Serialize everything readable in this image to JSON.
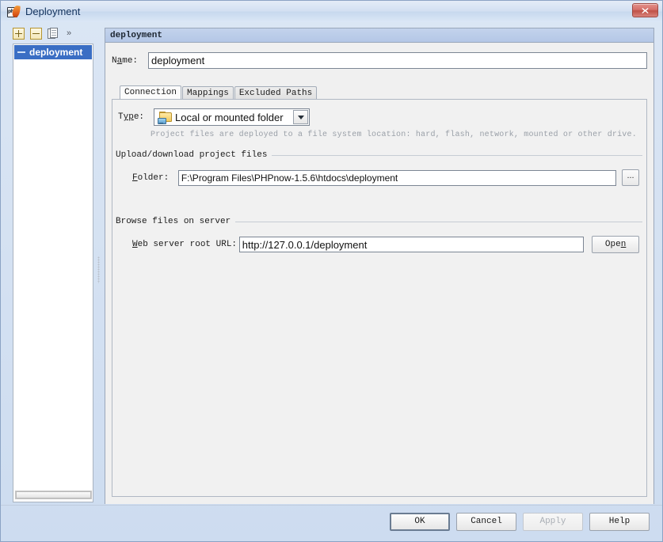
{
  "window": {
    "title": "Deployment",
    "icon": "php-flame-icon",
    "close_label": "close-icon",
    "accent_blue": "#3a6ec4",
    "header_blue": "#b4c7e6",
    "close_red": "#bf5148"
  },
  "sidebar": {
    "toolbar": [
      {
        "name": "add-button",
        "label": "+"
      },
      {
        "name": "remove-button",
        "label": "−"
      },
      {
        "name": "copy-button",
        "label": "copy"
      },
      {
        "name": "overflow-button",
        "label": "»"
      }
    ],
    "items": [
      {
        "label": "deployment",
        "selected": true
      }
    ]
  },
  "panel": {
    "header_title": "deployment",
    "name_label": "Name:",
    "name_label_pre": "N",
    "name_label_mn": "a",
    "name_label_post": "me:",
    "name_value": "deployment",
    "tabs": [
      {
        "label": "Connection",
        "active": true
      },
      {
        "label": "Mappings",
        "active": false
      },
      {
        "label": "Excluded Paths",
        "active": false
      }
    ],
    "type": {
      "label_pre": "T",
      "label_mn": "yp",
      "label_post": "e:",
      "label": "Type:",
      "value": "Local or mounted folder",
      "icon": "folder-mounted-icon",
      "arrow": "chevron-down-icon",
      "description": "Project files are deployed to a file system location: hard, flash, network, mounted or other drive."
    },
    "upload_group": {
      "title": "Upload/download project files",
      "folder_label": "Folder:",
      "folder_label_pre": "",
      "folder_label_mn": "F",
      "folder_label_post": "older:",
      "folder_value": "F:\\Program Files\\PHPnow-1.5.6\\htdocs\\deployment",
      "browse_label": "..."
    },
    "browse_group": {
      "title": "Browse files on server",
      "url_label": "Web server root URL:",
      "url_label_mn": "W",
      "url_label_post": "eb server root URL:",
      "url_value": "http://127.0.0.1/deployment",
      "open_button_pre": "Ope",
      "open_button_mn": "n",
      "open_button_label": "Open"
    }
  },
  "footer": {
    "buttons": [
      {
        "name": "ok-button",
        "label": "OK",
        "state": "default"
      },
      {
        "name": "cancel-button",
        "label": "Cancel",
        "state": "normal"
      },
      {
        "name": "apply-button",
        "label": "Apply",
        "state": "disabled"
      },
      {
        "name": "help-button",
        "label": "Help",
        "state": "normal"
      }
    ]
  }
}
